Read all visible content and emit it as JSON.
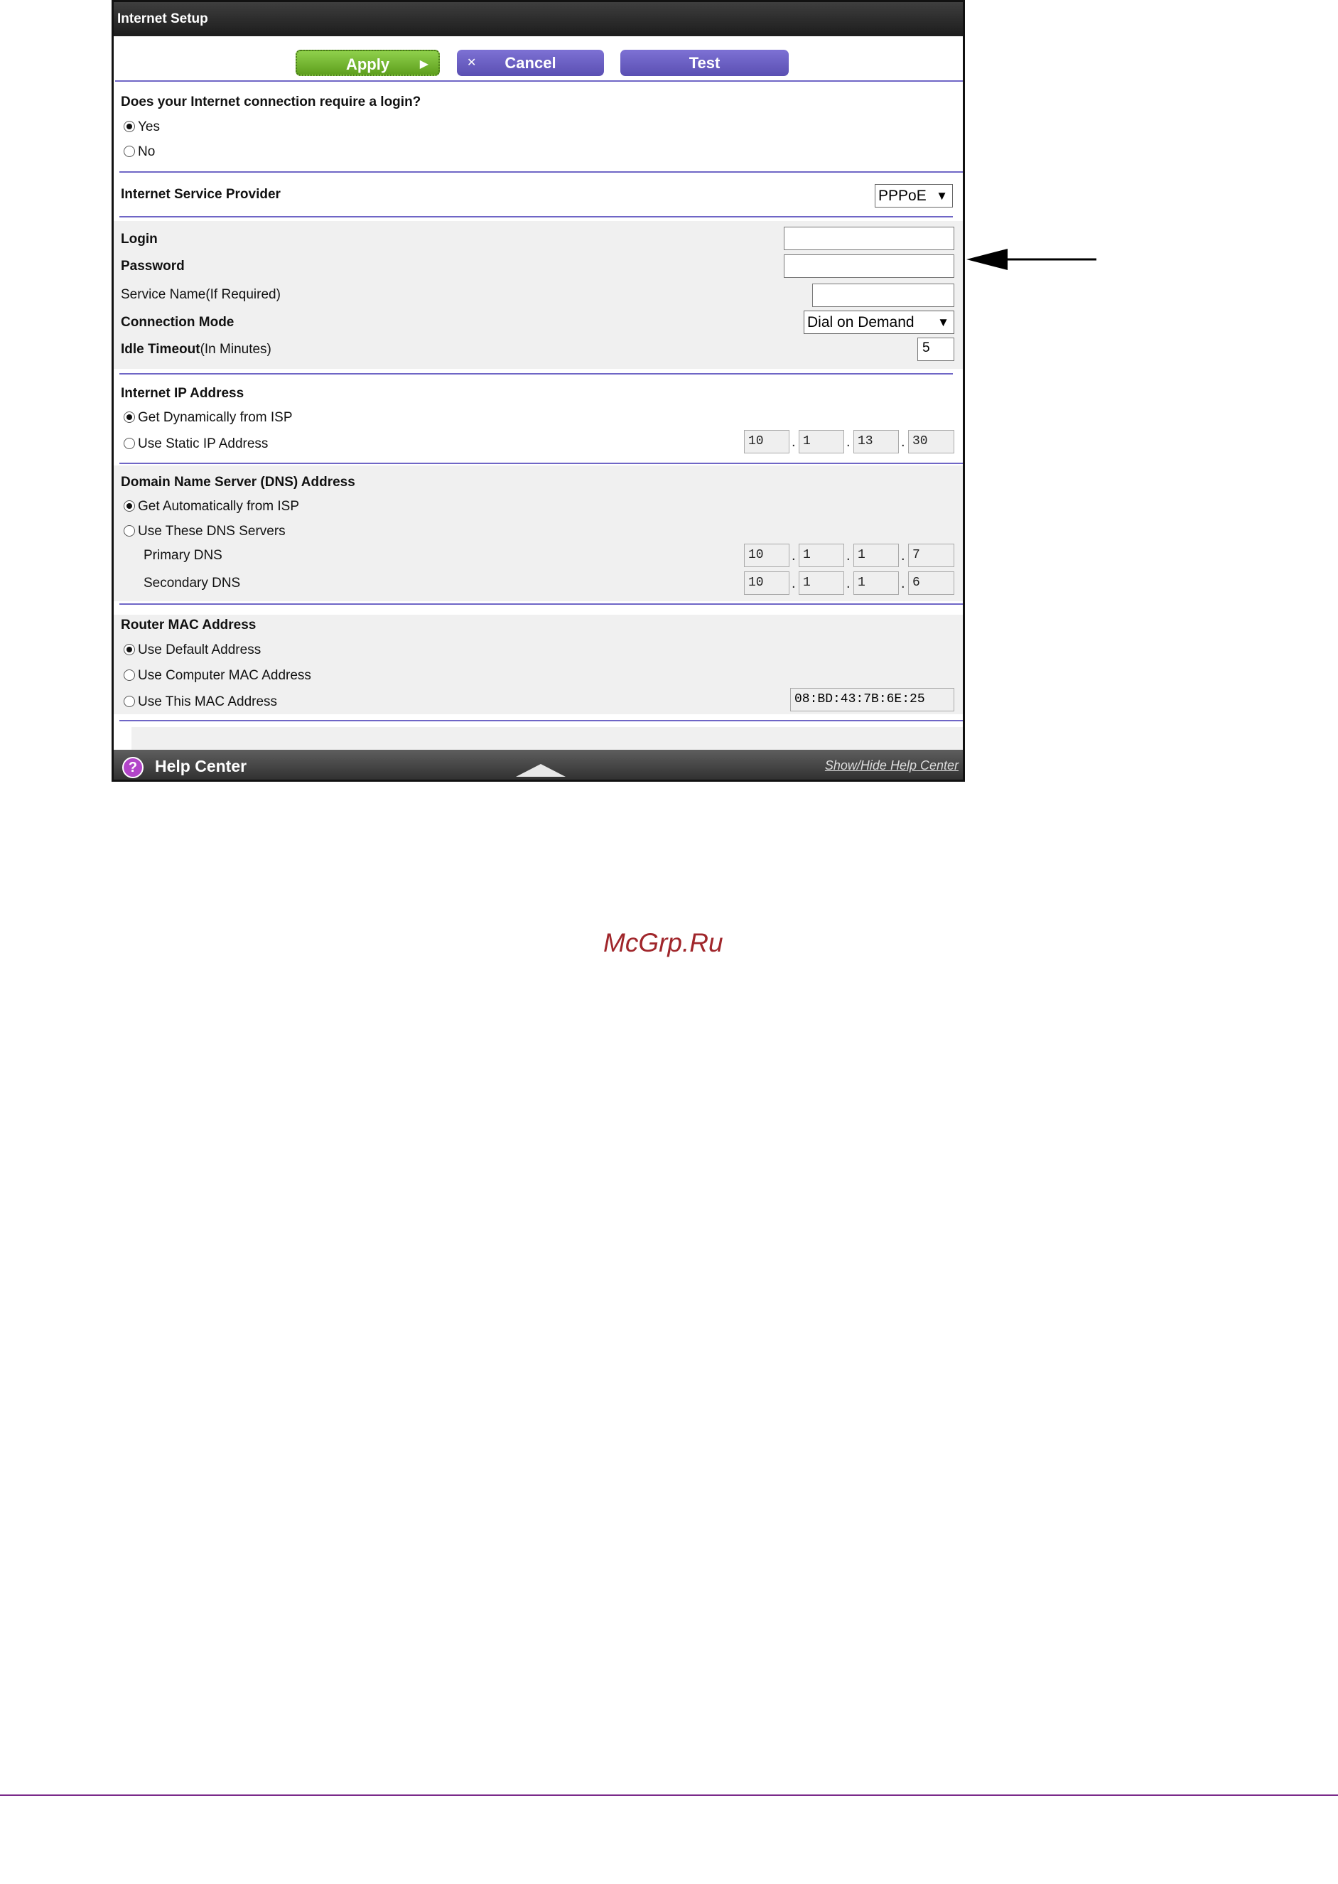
{
  "title": "Internet Setup",
  "buttons": {
    "apply": "Apply",
    "cancel": "Cancel",
    "test": "Test"
  },
  "login_question": {
    "label": "Does your Internet connection require a login?",
    "yes": "Yes",
    "no": "No",
    "selected": "Yes"
  },
  "isp": {
    "label": "Internet Service Provider",
    "value": "PPPoE"
  },
  "account": {
    "login_label": "Login",
    "password_label": "Password",
    "service_name_label": "Service Name(If Required)",
    "connection_mode_label": "Connection Mode",
    "connection_mode_value": "Dial on Demand",
    "idle_timeout_label_bold": "Idle Timeout",
    "idle_timeout_label_rest": "(In Minutes)",
    "idle_timeout_value": "5"
  },
  "ip_address": {
    "heading": "Internet IP Address",
    "option_dynamic": "Get Dynamically from ISP",
    "option_static": "Use Static IP Address",
    "selected": "Get Dynamically from ISP",
    "octets": [
      "10",
      "1",
      "13",
      "30"
    ]
  },
  "dns": {
    "heading": "Domain Name Server (DNS) Address",
    "option_auto": "Get Automatically from ISP",
    "option_manual": "Use These DNS Servers",
    "selected": "Get Automatically from ISP",
    "primary_label": "Primary DNS",
    "primary": [
      "10",
      "1",
      "1",
      "7"
    ],
    "secondary_label": "Secondary DNS",
    "secondary": [
      "10",
      "1",
      "1",
      "6"
    ]
  },
  "mac": {
    "heading": "Router MAC Address",
    "option_default": "Use Default Address",
    "option_computer": "Use Computer MAC Address",
    "option_this": "Use This MAC Address",
    "selected": "Use Default Address",
    "value": "08:BD:43:7B:6E:25"
  },
  "help_bar": {
    "label": "Help Center",
    "icon": "question-icon",
    "toggle_link": "Show/Hide Help Center"
  },
  "watermark": "McGrp.Ru",
  "colors": {
    "accent": "#6f66c6",
    "apply_green": "#6fb22f",
    "button_purple": "#6b60c4",
    "watermark": "#a0262b"
  }
}
